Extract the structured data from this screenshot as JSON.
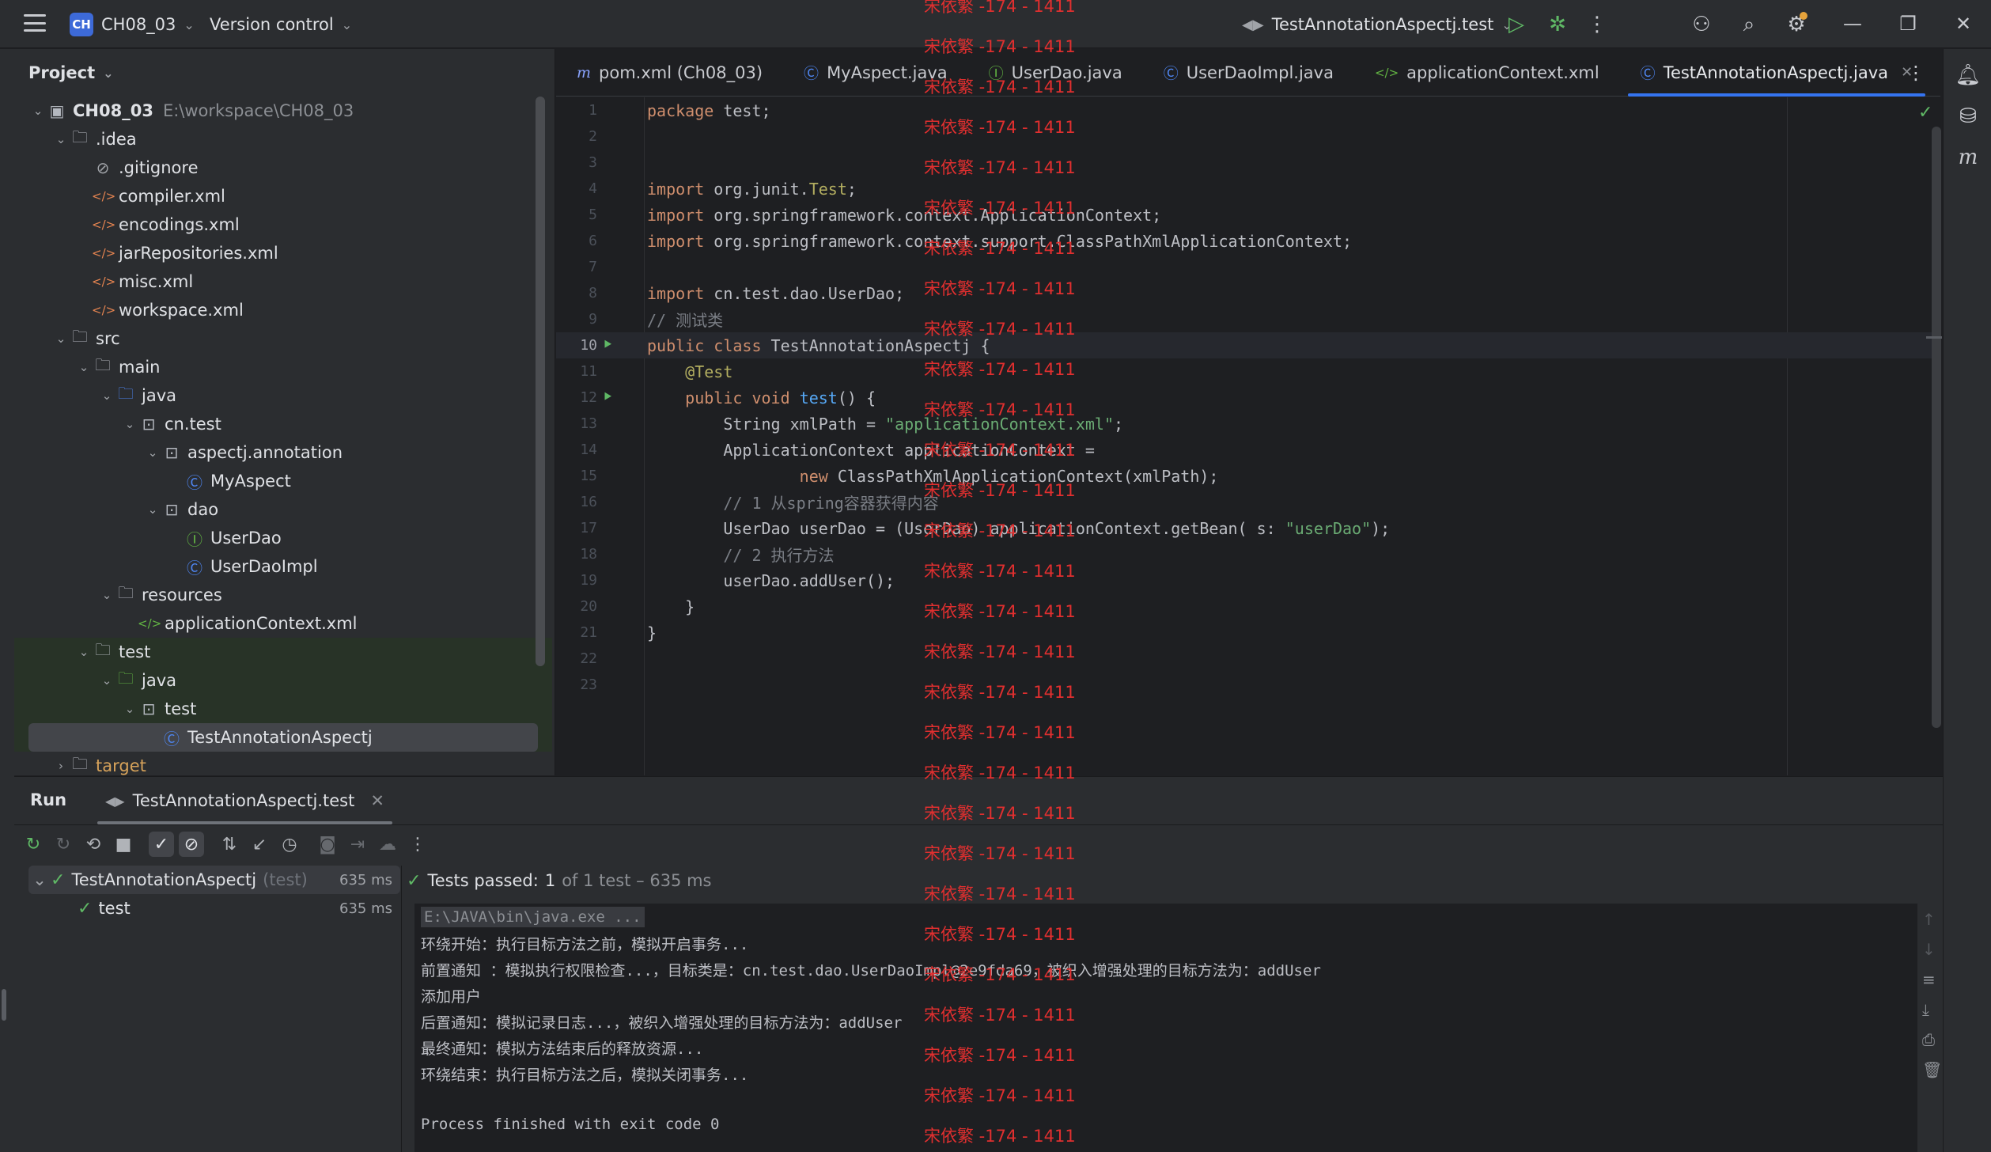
{
  "titlebar": {
    "project_badge": "CH",
    "project_name": "CH08_03",
    "vcs_label": "Version control",
    "run_config": "TestAnnotationAspectj.test"
  },
  "project_panel": {
    "title": "Project",
    "tree": [
      {
        "label": "CH08_03",
        "path": "E:\\workspace\\CH08_03",
        "icon": "module-folder",
        "depth": 0,
        "expanded": true,
        "bold": true
      },
      {
        "label": ".idea",
        "icon": "folder",
        "depth": 1,
        "expanded": true
      },
      {
        "label": ".gitignore",
        "icon": "ignore-file",
        "depth": 2
      },
      {
        "label": "compiler.xml",
        "icon": "xml-file",
        "depth": 2
      },
      {
        "label": "encodings.xml",
        "icon": "xml-file",
        "depth": 2
      },
      {
        "label": "jarRepositories.xml",
        "icon": "xml-file",
        "depth": 2
      },
      {
        "label": "misc.xml",
        "icon": "xml-file",
        "depth": 2
      },
      {
        "label": "workspace.xml",
        "icon": "xml-file",
        "depth": 2
      },
      {
        "label": "src",
        "icon": "folder",
        "depth": 1,
        "expanded": true
      },
      {
        "label": "main",
        "icon": "folder",
        "depth": 2,
        "expanded": true
      },
      {
        "label": "java",
        "icon": "source-folder",
        "depth": 3,
        "expanded": true
      },
      {
        "label": "cn.test",
        "icon": "package",
        "depth": 4,
        "expanded": true
      },
      {
        "label": "aspectj.annotation",
        "icon": "package",
        "depth": 5,
        "expanded": true
      },
      {
        "label": "MyAspect",
        "icon": "class",
        "depth": 6
      },
      {
        "label": "dao",
        "icon": "package",
        "depth": 5,
        "expanded": true
      },
      {
        "label": "UserDao",
        "icon": "interface",
        "depth": 6
      },
      {
        "label": "UserDaoImpl",
        "icon": "class",
        "depth": 6
      },
      {
        "label": "resources",
        "icon": "resources-folder",
        "depth": 3,
        "expanded": true
      },
      {
        "label": "applicationContext.xml",
        "icon": "spring-xml",
        "depth": 4
      },
      {
        "label": "test",
        "icon": "folder",
        "depth": 2,
        "expanded": true,
        "green": true
      },
      {
        "label": "java",
        "icon": "test-folder",
        "depth": 3,
        "expanded": true,
        "green": true
      },
      {
        "label": "test",
        "icon": "package",
        "depth": 4,
        "expanded": true,
        "green": true
      },
      {
        "label": "TestAnnotationAspectj",
        "icon": "class",
        "depth": 5,
        "green": true,
        "selected": true
      },
      {
        "label": "target",
        "icon": "folder",
        "depth": 1,
        "expanded": false,
        "orange": true
      }
    ]
  },
  "tabs": [
    {
      "label": "pom.xml (Ch08_03)",
      "icon": "maven-icon"
    },
    {
      "label": "MyAspect.java",
      "icon": "class-icon"
    },
    {
      "label": "UserDao.java",
      "icon": "interface-icon"
    },
    {
      "label": "UserDaoImpl.java",
      "icon": "class-icon"
    },
    {
      "label": "applicationContext.xml",
      "icon": "spring-xml-icon"
    },
    {
      "label": "TestAnnotationAspectj.java",
      "icon": "class-icon",
      "active": true
    }
  ],
  "editor": {
    "lines": [
      "package test;",
      "",
      "",
      "import org.junit.Test;",
      "import org.springframework.context.ApplicationContext;",
      "import org.springframework.context.support.ClassPathXmlApplicationContext;",
      "",
      "import cn.test.dao.UserDao;",
      "// 测试类",
      "public class TestAnnotationAspectj {",
      "    @Test",
      "    public void test() {",
      "        String xmlPath = \"applicationContext.xml\";",
      "        ApplicationContext applicationContext =",
      "                new ClassPathXmlApplicationContext(xmlPath);",
      "        // 1 从spring容器获得内容",
      "        UserDao userDao = (UserDao) applicationContext.getBean( s: \"userDao\");",
      "        // 2 执行方法",
      "        userDao.addUser();",
      "    }",
      "}",
      "",
      ""
    ],
    "current_line": 10,
    "param_hint": "s:"
  },
  "run_panel": {
    "title": "Run",
    "tab_label": "TestAnnotationAspectj.test",
    "tests": [
      {
        "name": "TestAnnotationAspectj",
        "suffix": "(test)",
        "duration": "635 ms"
      },
      {
        "name": "test",
        "duration": "635 ms"
      }
    ],
    "status": {
      "prefix": "Tests passed:",
      "count": "1",
      "rest": "of 1 test – 635 ms"
    },
    "console": [
      "E:\\JAVA\\bin\\java.exe ...",
      "环绕开始：执行目标方法之前，模拟开启事务...",
      "前置通知 ：模拟执行权限检查...，目标类是：cn.test.dao.UserDaoImpl@2e9fda69，被织入增强处理的目标方法为：addUser",
      "添加用户",
      "后置通知：模拟记录日志...，被织入增强处理的目标方法为：addUser",
      "最终通知：模拟方法结束后的释放资源...",
      "环绕结束：执行目标方法之后，模拟关闭事务...",
      "",
      "Process finished with exit code 0"
    ]
  },
  "watermark": {
    "text": "宋依繁 -174 - 1411",
    "count": 29
  },
  "colors": {
    "accent": "#3574f0",
    "success": "#5fb865",
    "watermark": "#e02f2f"
  }
}
